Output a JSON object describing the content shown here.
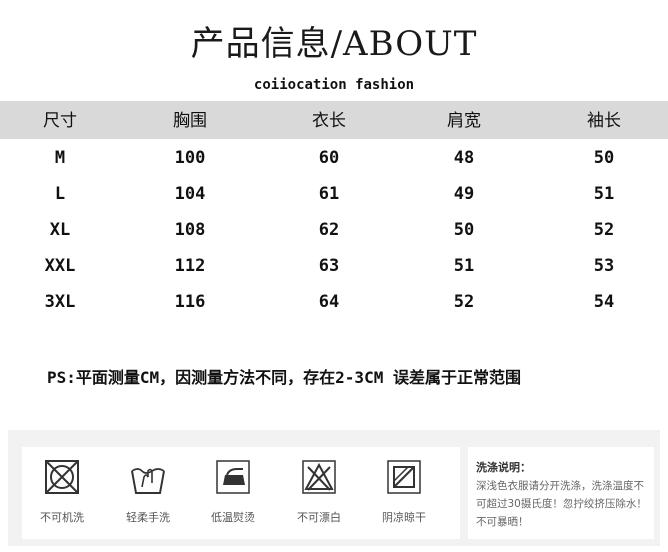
{
  "header": {
    "title": "产品信息/ABOUT",
    "subtitle": "coiiocation fashion"
  },
  "size_table": {
    "columns": [
      "尺寸",
      "胸围",
      "衣长",
      "肩宽",
      "袖长"
    ],
    "rows": [
      [
        "M",
        "100",
        "60",
        "48",
        "50"
      ],
      [
        "L",
        "104",
        "61",
        "49",
        "51"
      ],
      [
        "XL",
        "108",
        "62",
        "50",
        "52"
      ],
      [
        "XXL",
        "112",
        "63",
        "51",
        "53"
      ],
      [
        "3XL",
        "116",
        "64",
        "52",
        "54"
      ]
    ]
  },
  "note": "PS:平面测量CM，因测量方法不同，存在2-3CM 误差属于正常范围",
  "care": {
    "items": [
      {
        "label": "不可机洗",
        "icon": "no-machine-wash-icon"
      },
      {
        "label": "轻柔手洗",
        "icon": "hand-wash-icon"
      },
      {
        "label": "低温熨烫",
        "icon": "low-temp-iron-icon"
      },
      {
        "label": "不可漂白",
        "icon": "no-bleach-icon"
      },
      {
        "label": "阴凉晾干",
        "icon": "shade-dry-icon"
      }
    ],
    "instructions_title": "洗涤说明：",
    "instructions_text": "深浅色衣服请分开洗涤，洗涤温度不可超过30摄氏度！忽拧绞挤压除水！不可暴晒！"
  }
}
